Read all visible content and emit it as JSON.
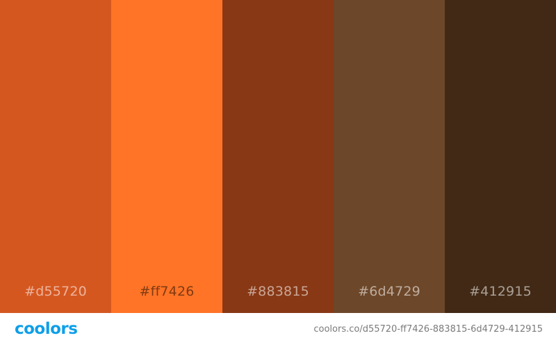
{
  "palette": {
    "colors": [
      {
        "hex": "#d55720",
        "label": "#d55720",
        "text_tone": "light-on-dark"
      },
      {
        "hex": "#ff7426",
        "label": "#ff7426",
        "text_tone": "dark-on-light"
      },
      {
        "hex": "#883815",
        "label": "#883815",
        "text_tone": "light-on-dark"
      },
      {
        "hex": "#6d4729",
        "label": "#6d4729",
        "text_tone": "light-on-dark"
      },
      {
        "hex": "#412915",
        "label": "#412915",
        "text_tone": "light-on-dark"
      }
    ]
  },
  "footer": {
    "logo_text": "coolors",
    "logo_color": "#0e9fe8",
    "url_text": "coolors.co/d55720-ff7426-883815-6d4729-412915"
  }
}
